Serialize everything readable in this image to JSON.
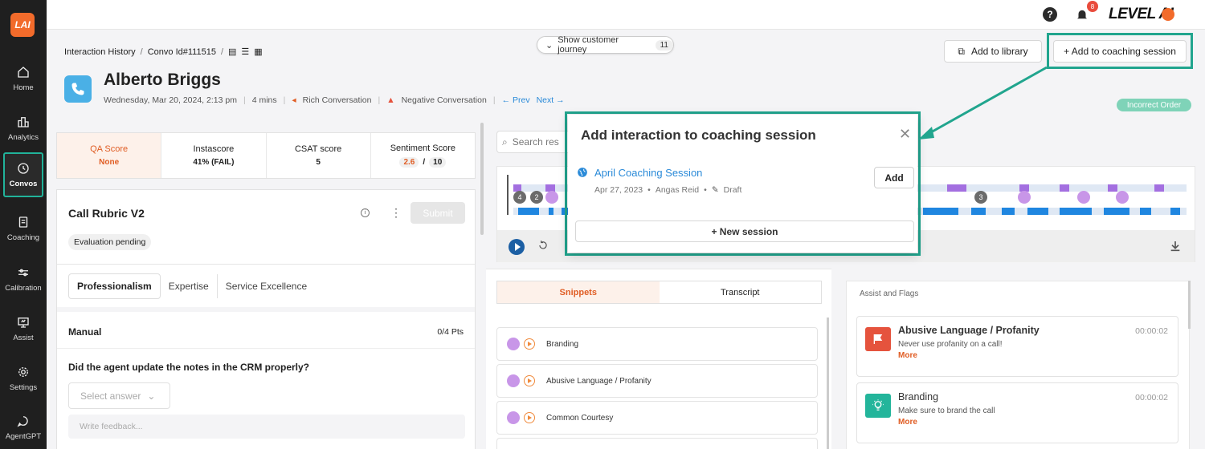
{
  "app": {
    "logo_text": "LAI",
    "brand_text": "LEVEL AI",
    "notification_count": "8"
  },
  "sidebar": {
    "items": [
      {
        "label": "Home",
        "icon": "home-icon"
      },
      {
        "label": "Analytics",
        "icon": "analytics-icon"
      },
      {
        "label": "Convos",
        "icon": "history-icon",
        "active": true
      },
      {
        "label": "Coaching",
        "icon": "document-icon"
      },
      {
        "label": "Calibration",
        "icon": "sliders-icon"
      },
      {
        "label": "Assist",
        "icon": "presentation-icon"
      },
      {
        "label": "Settings",
        "icon": "gear-icon"
      },
      {
        "label": "AgentGPT",
        "icon": "chat-icon"
      }
    ]
  },
  "header": {
    "breadcrumb": [
      "Interaction History",
      "Convo Id#111515"
    ],
    "journey_label": "Show customer journey",
    "journey_count": "11",
    "add_library_label": "Add to library",
    "add_coaching_label": "+ Add to coaching session",
    "contact_name": "Alberto Briggs",
    "meta_date": "Wednesday, Mar 20, 2024, 2:13 pm",
    "meta_duration": "4 mins",
    "meta_tag1": "Rich Conversation",
    "meta_tag2": "Negative Conversation",
    "prev_label": "← Prev",
    "next_label": "Next →",
    "status_badge": "Incorrect Order"
  },
  "scores": {
    "qa_label": "QA Score",
    "qa_value": "None",
    "insta_label": "Instascore",
    "insta_value": "41% (FAIL)",
    "csat_label": "CSAT score",
    "csat_value": "5",
    "sentiment_label": "Sentiment Score",
    "sentiment_value": "2.6",
    "sentiment_sep": "/",
    "sentiment_max": "10"
  },
  "rubric": {
    "title": "Call Rubric V2",
    "submit_label": "Submit",
    "status": "Evaluation pending",
    "tabs": [
      "Professionalism",
      "Expertise",
      "Service Excellence"
    ],
    "section_name": "Manual",
    "section_points": "0/4 Pts",
    "question": "Did the agent update the notes in the CRM properly?",
    "answer_placeholder": "Select answer",
    "feedback_placeholder": "Write feedback..."
  },
  "player": {
    "search_placeholder": "Search res",
    "markers": [
      "4",
      "2",
      "3"
    ]
  },
  "snippets": {
    "tabs": [
      "Snippets",
      "Transcript"
    ],
    "items": [
      "Branding",
      "Abusive Language / Profanity",
      "Common Courtesy"
    ]
  },
  "assist": {
    "title": "Assist and Flags",
    "flags": [
      {
        "title": "Abusive Language / Profanity",
        "desc": "Never use profanity on a call!",
        "more": "More",
        "time": "00:00:02",
        "color": "#e5533d"
      },
      {
        "title": "Branding",
        "desc": "Make sure to brand the call",
        "more": "More",
        "time": "00:00:02",
        "color": "#23b59b"
      }
    ]
  },
  "modal": {
    "title": "Add interaction to coaching session",
    "session_name": "April Coaching Session",
    "session_date": "Apr 27, 2023",
    "session_owner": "Angas Reid",
    "session_status": "Draft",
    "add_label": "Add",
    "new_session_label": "+ New session"
  },
  "colors": {
    "accent": "#e05d24",
    "highlight": "#21a58e",
    "link": "#2a8ad8",
    "sidebar_bg": "#1f1f1f"
  }
}
